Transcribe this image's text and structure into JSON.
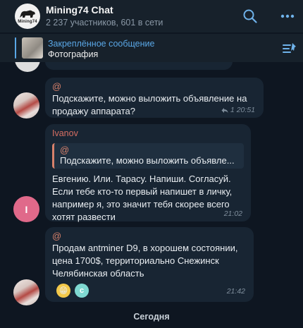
{
  "header": {
    "avatar_text": "Mining74",
    "title": "Mining74 Chat",
    "subtitle": "2 237 участников, 601 в сети"
  },
  "pinned": {
    "title": "Закреплённое сообщение",
    "text": "Фотография"
  },
  "messages": [
    {
      "mention": "@",
      "text": "Подскажите, можно выложить объявление на продажу аппарата?",
      "replies": "1",
      "time": "20:51"
    },
    {
      "sender": "Ivanov",
      "avatar_letter": "I",
      "quote_mention": "@",
      "quote_text": "Подскажите, можно выложить объявле...",
      "text": "Евгению. Или. Тарасу. Напиши. Согласуй. Если тебе кто-то первый напишет в личку, например я, это значит тебя скорее всего хотят развести",
      "time": "21:02"
    },
    {
      "mention": "@",
      "text": "Продам antminer D9, в хорошем состоянии, цена 1700$, территориально Снежинск Челябинская область",
      "reactions": [
        "😁",
        "c"
      ],
      "time": "21:42"
    }
  ],
  "date_separator": "Сегодня",
  "colors": {
    "background": "#0e1621",
    "panel": "#17212b",
    "bubble": "#182533",
    "accent": "#5aa7e6",
    "sender": "#d76f63"
  }
}
